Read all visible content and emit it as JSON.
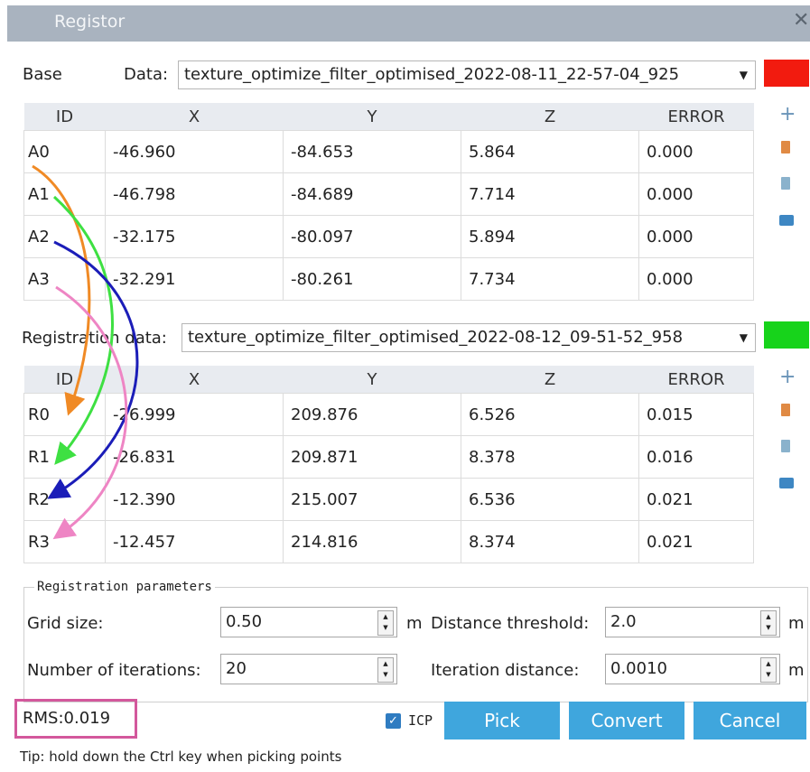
{
  "window": {
    "title": "Registor",
    "close_glyph": "✕"
  },
  "base": {
    "section_label": "Base",
    "data_label": "Data:",
    "dataset": "texture_optimize_filter_optimised_2022-08-11_22-57-04_925",
    "color": "#f21b0f",
    "columns": [
      "ID",
      "X",
      "Y",
      "Z",
      "ERROR"
    ],
    "rows": [
      [
        "A0",
        "-46.960",
        "-84.653",
        "5.864",
        "0.000"
      ],
      [
        "A1",
        "-46.798",
        "-84.689",
        "7.714",
        "0.000"
      ],
      [
        "A2",
        "-32.175",
        "-80.097",
        "5.894",
        "0.000"
      ],
      [
        "A3",
        "-32.291",
        "-80.261",
        "7.734",
        "0.000"
      ]
    ]
  },
  "registration": {
    "data_label": "Registration data:",
    "dataset": "texture_optimize_filter_optimised_2022-08-12_09-51-52_958",
    "color": "#17d31b",
    "columns": [
      "ID",
      "X",
      "Y",
      "Z",
      "ERROR"
    ],
    "rows": [
      [
        "R0",
        "-26.999",
        "209.876",
        "6.526",
        "0.015"
      ],
      [
        "R1",
        "-26.831",
        "209.871",
        "8.378",
        "0.016"
      ],
      [
        "R2",
        "-12.390",
        "215.007",
        "6.536",
        "0.021"
      ],
      [
        "R3",
        "-12.457",
        "214.816",
        "8.374",
        "0.021"
      ]
    ]
  },
  "side_icons": [
    "plus-icon",
    "trash-icon",
    "clear-icon",
    "folder-icon"
  ],
  "parameters": {
    "legend": "Registration parameters",
    "grid_size_label": "Grid size:",
    "grid_size_value": "0.50",
    "grid_size_unit": "m",
    "distance_threshold_label": "Distance threshold:",
    "distance_threshold_value": "2.0",
    "distance_threshold_unit": "m",
    "iterations_label": "Number of iterations:",
    "iterations_value": "20",
    "iteration_distance_label": "Iteration distance:",
    "iteration_distance_value": "0.0010",
    "iteration_distance_unit": "m"
  },
  "rms": "RMS:0.019",
  "icp": {
    "label": "ICP",
    "checked": true
  },
  "buttons": {
    "pick": "Pick",
    "convert": "Convert",
    "cancel": "Cancel"
  },
  "tip": "Tip: hold down the Ctrl key when picking points",
  "annotation_colors": {
    "a0": "#f08a25",
    "a1": "#3ee042",
    "a2": "#1b1db8",
    "a3": "#ee85c4",
    "rms_box": "#d3589c"
  }
}
